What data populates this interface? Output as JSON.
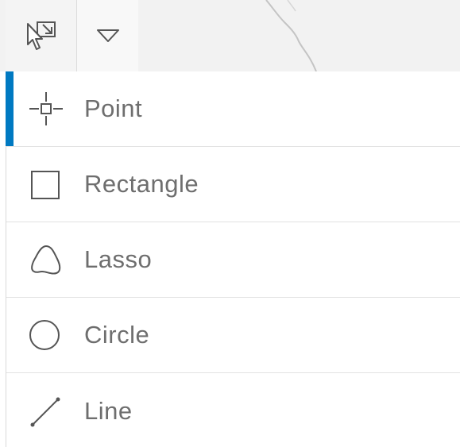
{
  "toolbar": {
    "select_tool_icon": "select-cursor-icon",
    "dropdown_icon": "triangle-down-icon"
  },
  "menu": {
    "items": [
      {
        "label": "Point",
        "icon": "point-crosshair-icon",
        "active": true
      },
      {
        "label": "Rectangle",
        "icon": "rectangle-icon",
        "active": false
      },
      {
        "label": "Lasso",
        "icon": "lasso-icon",
        "active": false
      },
      {
        "label": "Circle",
        "icon": "circle-icon",
        "active": false
      },
      {
        "label": "Line",
        "icon": "line-icon",
        "active": false
      }
    ]
  },
  "colors": {
    "accent": "#0079c1",
    "label_text": "#6e6e6e",
    "icon_stroke": "#555555",
    "map_background": "#f2f2f2"
  }
}
